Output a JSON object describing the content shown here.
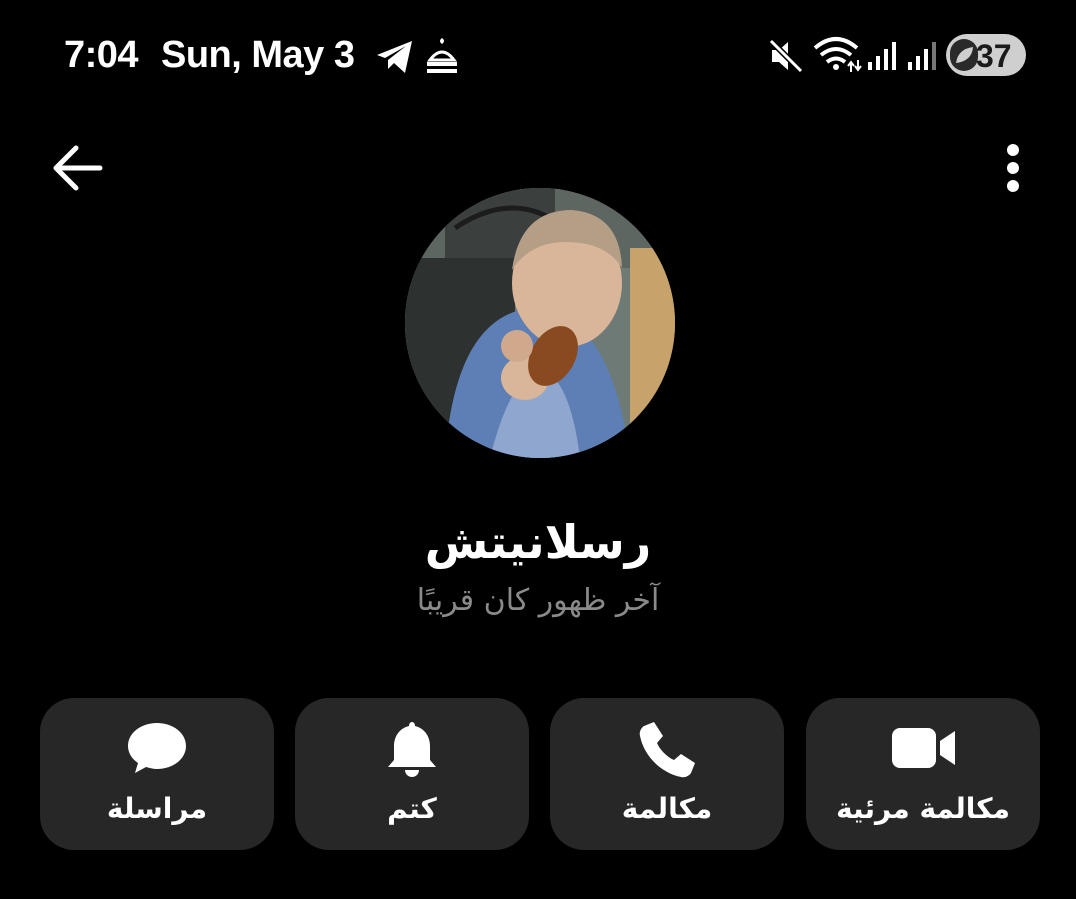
{
  "status_bar": {
    "time": "7:04",
    "date": "Sun, May 3",
    "battery_level": "37",
    "icons": [
      "telegram-icon",
      "mosque-icon",
      "mute-icon",
      "wifi-icon",
      "signal-icon",
      "signal-icon",
      "battery-saver-icon"
    ]
  },
  "header": {
    "back_icon": "back-arrow-icon",
    "menu_icon": "more-vert-icon"
  },
  "profile": {
    "name": "رسلانيتش",
    "last_seen": "آخر ظهور كان قريبًا"
  },
  "actions": [
    {
      "label": "مراسلة",
      "icon": "chat-bubble-icon"
    },
    {
      "label": "كتم",
      "icon": "bell-icon"
    },
    {
      "label": "مكالمة",
      "icon": "phone-icon"
    },
    {
      "label": "مكالمة مرئية",
      "icon": "video-icon"
    }
  ],
  "colors": {
    "background": "#000000",
    "button_bg": "#272727",
    "status_text": "#8a8a8a",
    "battery_bg": "#cfcfcf"
  }
}
